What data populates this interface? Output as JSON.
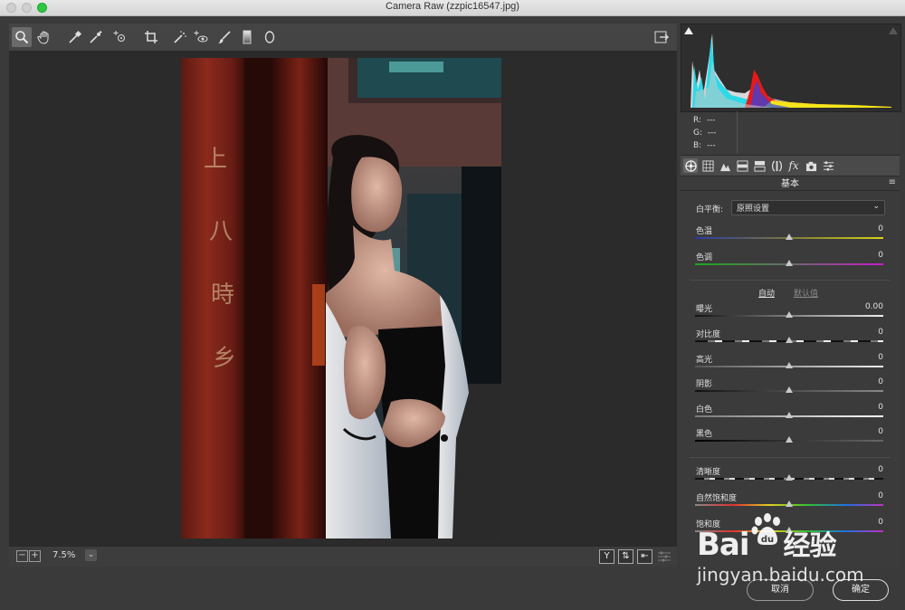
{
  "window": {
    "title": "Camera Raw (zzpic16547.jpg)"
  },
  "toolbar": {
    "tools": [
      "zoom-tool",
      "hand-tool",
      "white-balance-tool",
      "color-sampler-tool",
      "targeted-adjustment-tool",
      "crop-tool",
      "spot-removal-tool",
      "red-eye-tool",
      "adjustment-brush-tool",
      "graduated-filter-tool",
      "radial-filter-tool"
    ],
    "open_preferences_icon": "export-icon"
  },
  "status": {
    "zoom": "7.5%"
  },
  "view_buttons": [
    "Y",
    "⇅",
    "⇤"
  ],
  "readout": {
    "r_label": "R:",
    "r_value": "---",
    "g_label": "G:",
    "g_value": "---",
    "b_label": "B:",
    "b_value": "---"
  },
  "panel": {
    "section_title": "基本",
    "white_balance_label": "白平衡:",
    "white_balance_value": "原照设置",
    "auto_label": "自动",
    "default_label": "默认值",
    "temp": {
      "label": "色温",
      "value": "0",
      "level": 0.5
    },
    "tint": {
      "label": "色调",
      "value": "0",
      "level": 0.5
    },
    "exposure": {
      "label": "曝光",
      "value": "0.00",
      "level": 0.5
    },
    "contrast": {
      "label": "对比度",
      "value": "0",
      "level": 0.5
    },
    "highlights": {
      "label": "高光",
      "value": "0",
      "level": 0.5
    },
    "shadows": {
      "label": "阴影",
      "value": "0",
      "level": 0.5
    },
    "whites": {
      "label": "白色",
      "value": "0",
      "level": 0.5
    },
    "blacks": {
      "label": "黑色",
      "value": "0",
      "level": 0.5
    },
    "clarity": {
      "label": "清晰度",
      "value": "0",
      "level": 0.5
    },
    "vibrance": {
      "label": "自然饱和度",
      "value": "0",
      "level": 0.5
    },
    "saturation": {
      "label": "饱和度",
      "value": "0",
      "level": 0.5
    }
  },
  "buttons": {
    "cancel": "取消",
    "ok": "确定"
  },
  "watermark": {
    "brand": "Bai",
    "brand2": "经验",
    "url": "jingyan.baidu.com"
  },
  "photo": {
    "sign_text": [
      "上",
      "八",
      "時",
      "乡"
    ]
  },
  "colors": {
    "accent_green": "#2bc840",
    "panel_bg": "#3b3b3b",
    "canvas_bg": "#2b2b2b"
  }
}
